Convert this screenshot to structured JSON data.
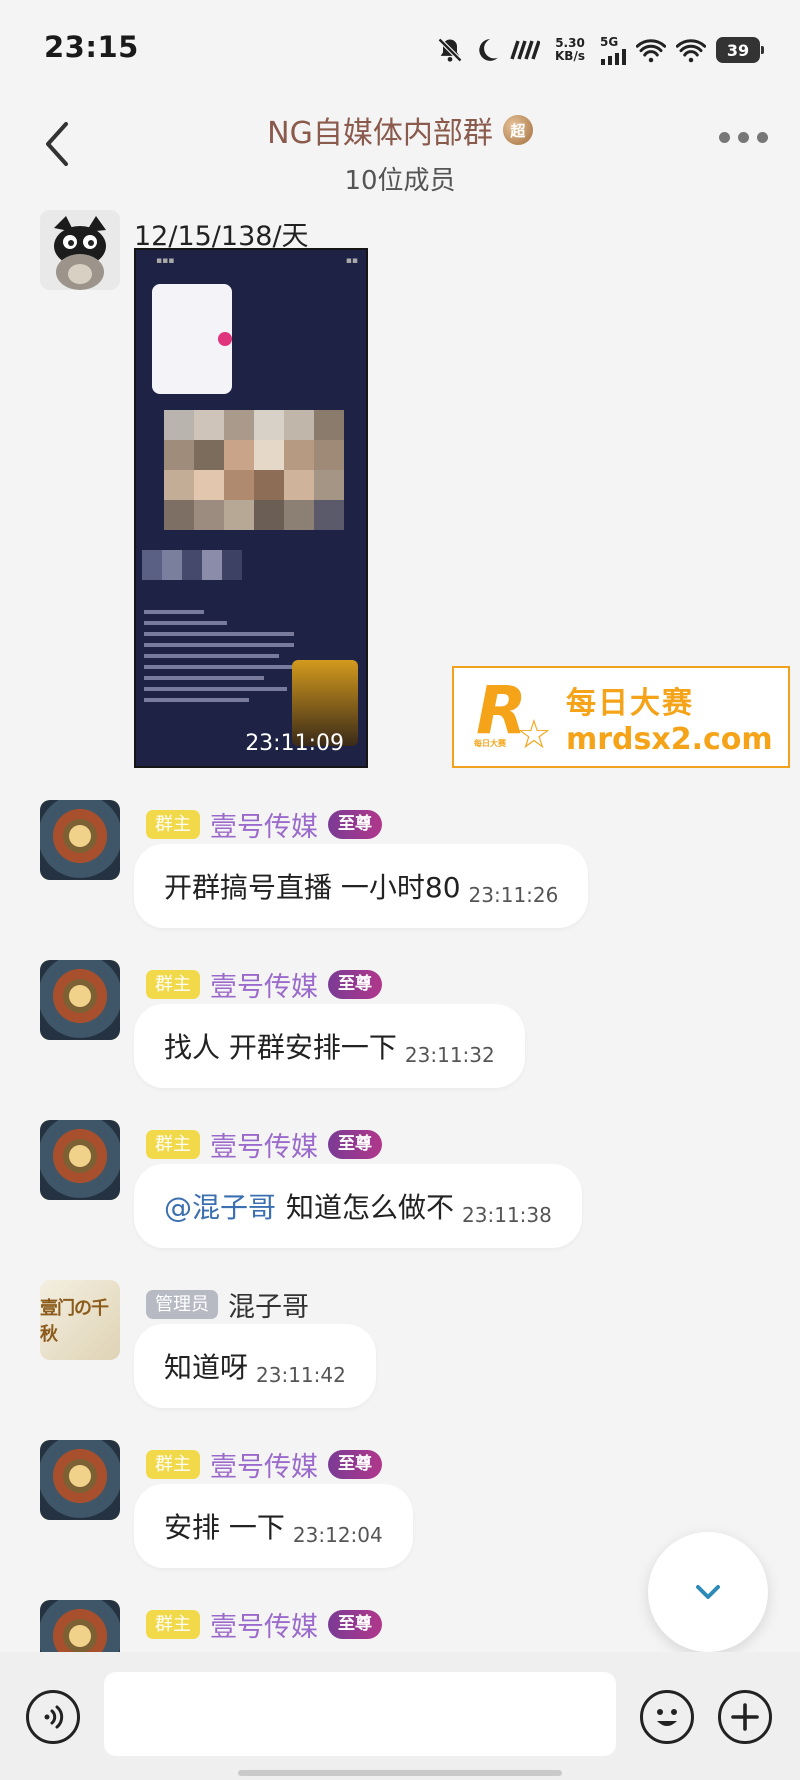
{
  "status_bar": {
    "time": "23:15",
    "net_speed_value": "5.30",
    "net_speed_unit": "KB/s",
    "network_type": "5G",
    "battery": "39",
    "icons": [
      "mute-bell-icon",
      "moon-icon",
      "carrier-logo-icon",
      "signal-icon",
      "wifi-icon",
      "wifi-icon",
      "battery-icon"
    ]
  },
  "header": {
    "title": "NG自媒体内部群",
    "badge": "超",
    "members": "10位成员"
  },
  "messages": [
    {
      "caption": "12/15/138/天",
      "image_time": "23:11:09"
    },
    {
      "role": "群主",
      "name": "壹号传媒",
      "vip": "至尊",
      "text": "开群搞号直播   一小时80",
      "time": "23:11:26"
    },
    {
      "role": "群主",
      "name": "壹号传媒",
      "vip": "至尊",
      "text": "找人 开群安排一下",
      "time": "23:11:32"
    },
    {
      "role": "群主",
      "name": "壹号传媒",
      "vip": "至尊",
      "mention": "@混子哥",
      "text": "知道怎么做不",
      "time": "23:11:38"
    },
    {
      "role": "管理员",
      "name": "混子哥",
      "avatar_text": "壹门の千秋",
      "text": "知道呀",
      "time": "23:11:42"
    },
    {
      "role": "群主",
      "name": "壹号传媒",
      "vip": "至尊",
      "text": "安排 一下",
      "time": "23:12:04"
    },
    {
      "role": "群主",
      "name": "壹号传媒",
      "vip": "至尊"
    }
  ],
  "watermark": {
    "brand": "每日大赛",
    "url": "mrdsx2.com",
    "logo_letter": "R",
    "logo_small": "每日大赛"
  },
  "input": {
    "placeholder": ""
  },
  "colors": {
    "owner_tag": "#f1d94a",
    "vip_tag": "#a2388e",
    "name_purple": "#9b6bcb",
    "watermark": "#f5a419",
    "title": "#8a5a4c"
  }
}
